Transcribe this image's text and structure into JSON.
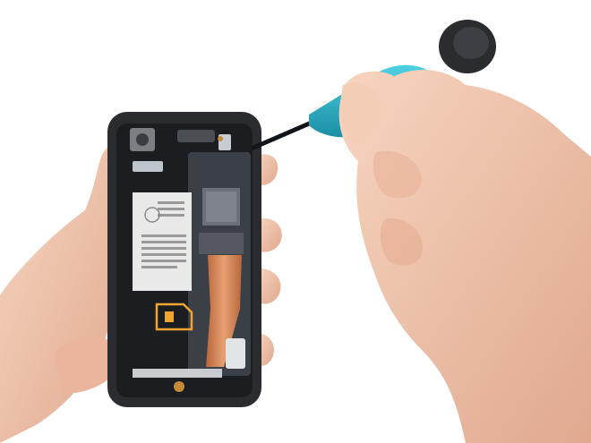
{
  "photo": {
    "colors": {
      "background": "#ffffff",
      "skin": "#f2c9b0",
      "skin_shadow": "#d99f86",
      "phone_body": "#2a2c30",
      "phone_inner": "#1c1d21",
      "board": "#3b3f46",
      "copper": "#d9875a",
      "sticker": "#e9e9e9",
      "sim_marker": "#f0a531",
      "driver_shaft": "#111418",
      "driver_handle": "#2bb3c9",
      "driver_cap": "#2a2c30"
    }
  }
}
